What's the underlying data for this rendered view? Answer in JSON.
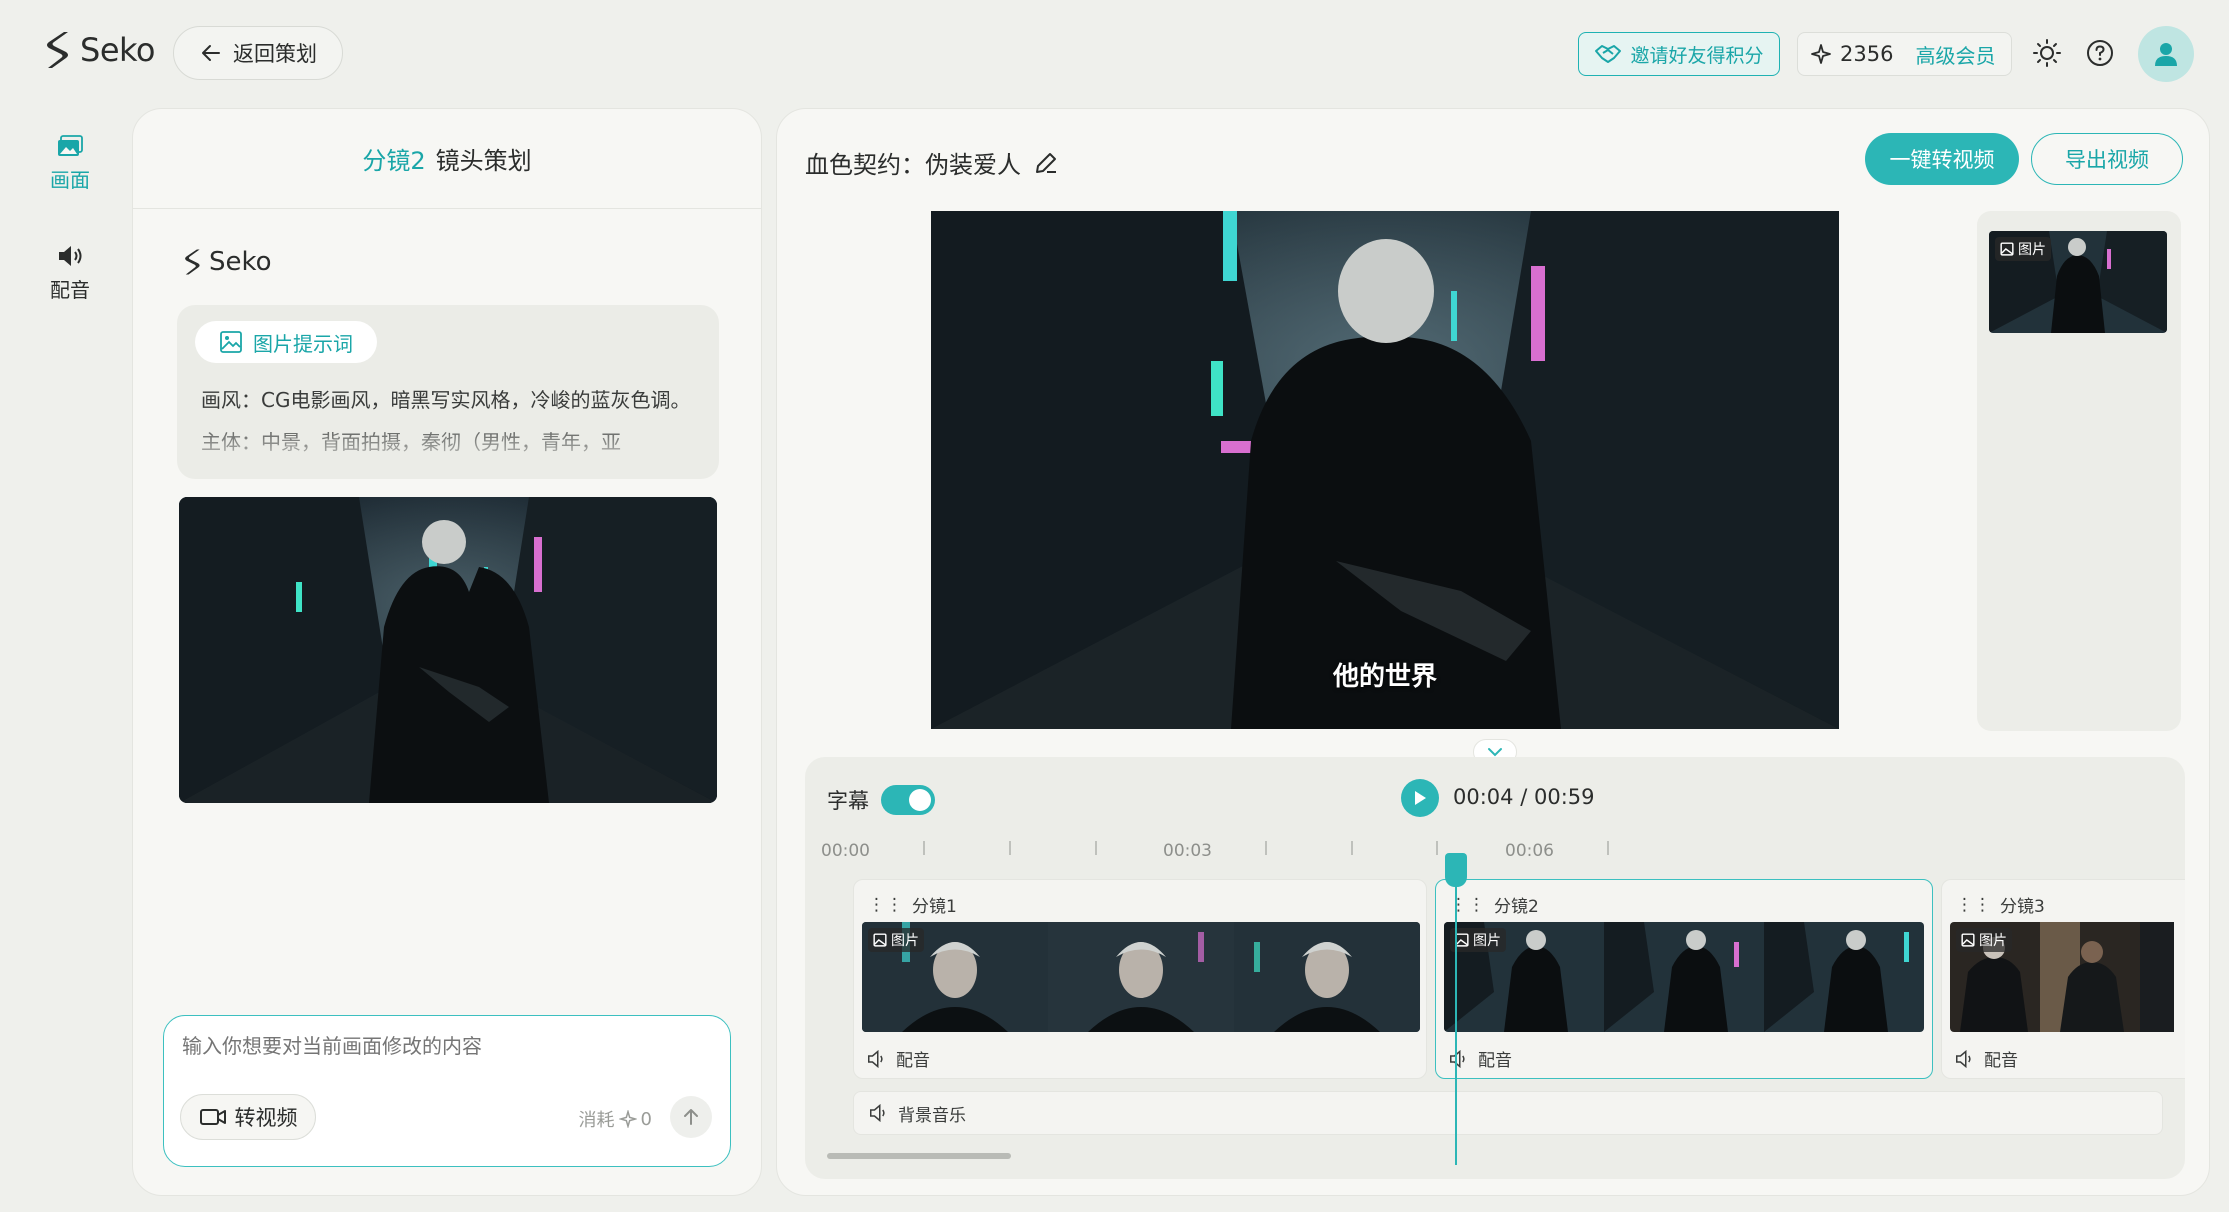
{
  "app": {
    "name": "Seko"
  },
  "topbar": {
    "back_label": "返回策划",
    "invite_label": "邀请好友得积分",
    "points": "2356",
    "membership": "高级会员",
    "icons": [
      "sparkle-icon",
      "sun-icon",
      "help-icon",
      "user-icon"
    ]
  },
  "nav": {
    "items": [
      {
        "label": "画面",
        "icon": "image-icon",
        "active": true
      },
      {
        "label": "配音",
        "icon": "speaker-icon",
        "active": false
      }
    ]
  },
  "left_panel": {
    "shot_name": "分镜2",
    "header_title": "镜头策划",
    "assistant_name": "Seko",
    "prompt_chip_label": "图片提示词",
    "prompt_text": "画风：CG电影画风，暗黑写实风格，冷峻的蓝灰色调。主体：中景，背面拍摄，秦彻（男性，青年，亚",
    "input_placeholder": "输入你想要对当前画面修改的内容",
    "convert_label": "转视频",
    "cost_label": "消耗",
    "cost_value": "0"
  },
  "right_panel": {
    "project_title": "血色契约：伪装爱人",
    "generate_label": "一键转视频",
    "export_label": "导出视频",
    "preview_subtitle": "他的世界",
    "thumb_tag": "图片"
  },
  "timeline": {
    "subtitle_label": "字幕",
    "subtitle_enabled": true,
    "current_time": "00:04",
    "total_time": "00:59",
    "ruler_labels": [
      "00:00",
      "00:03",
      "00:06"
    ],
    "clips": [
      {
        "name": "分镜1",
        "tag": "图片",
        "audio": "配音",
        "active": false
      },
      {
        "name": "分镜2",
        "tag": "图片",
        "audio": "配音",
        "active": true
      },
      {
        "name": "分镜3",
        "tag": "图片",
        "audio": "配音",
        "active": false
      }
    ],
    "bgm_label": "背景音乐"
  },
  "colors": {
    "accent": "#2cb6b6",
    "accent_text": "#1aa6a8",
    "bg": "#eff0ec"
  }
}
